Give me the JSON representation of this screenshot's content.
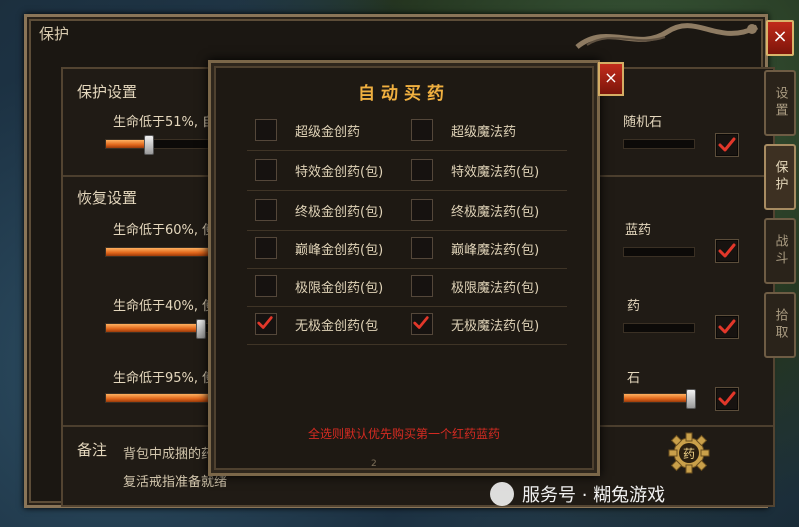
{
  "window": {
    "title": "保护",
    "close_glyph": "×"
  },
  "side_tabs": [
    {
      "label": "设置",
      "active": false
    },
    {
      "label": "保护",
      "active": true
    },
    {
      "label": "战斗",
      "active": false
    },
    {
      "label": "拾取",
      "active": false
    }
  ],
  "protect": {
    "section_label": "保护设置",
    "row1": {
      "label": "生命低于51%, 自动",
      "right_text": "随机石",
      "slider": 0.32,
      "checked": true
    }
  },
  "recover": {
    "section_label": "恢复设置",
    "rows": [
      {
        "label": "生命低于60%, 使用",
        "right_text": "蓝药",
        "slider": 1.0,
        "checked": true
      },
      {
        "label": "生命低于40%, 使用",
        "right_text": "药",
        "slider": 0.72,
        "checked": true
      },
      {
        "label": "生命低于95%, 使用",
        "right_text": "石",
        "slider": 0.98,
        "checked": true
      }
    ]
  },
  "notes": {
    "label": "备注",
    "line1": "背包中成捆的药水",
    "line2": "复活戒指准备就绪"
  },
  "gear_button": {
    "glyph": "药"
  },
  "popup": {
    "title": "自动买药",
    "close_glyph": "×",
    "items": [
      [
        {
          "label": "超级金创药",
          "checked": false
        },
        {
          "label": "超级魔法药",
          "checked": false
        }
      ],
      [
        {
          "label": "特效金创药(包)",
          "checked": false
        },
        {
          "label": "特效魔法药(包)",
          "checked": false
        }
      ],
      [
        {
          "label": "终极金创药(包)",
          "checked": false
        },
        {
          "label": "终极魔法药(包)",
          "checked": false
        }
      ],
      [
        {
          "label": "巅峰金创药(包)",
          "checked": false
        },
        {
          "label": "巅峰魔法药(包)",
          "checked": false
        }
      ],
      [
        {
          "label": "极限金创药(包)",
          "checked": false
        },
        {
          "label": "极限魔法药(包)",
          "checked": false
        }
      ],
      [
        {
          "label": "无极金创药(包",
          "checked": true
        },
        {
          "label": "无极魔法药(包)",
          "checked": true
        }
      ]
    ],
    "note": "全选则默认优先购买第一个红药蓝药",
    "page_indicator": "2"
  },
  "watermark": {
    "text": "服务号 · 糊兔游戏"
  },
  "colors": {
    "accent_orange": "#e0651a",
    "check_red": "#e2372a",
    "note_red": "#d62b22",
    "title_gold": "#f0b040"
  }
}
